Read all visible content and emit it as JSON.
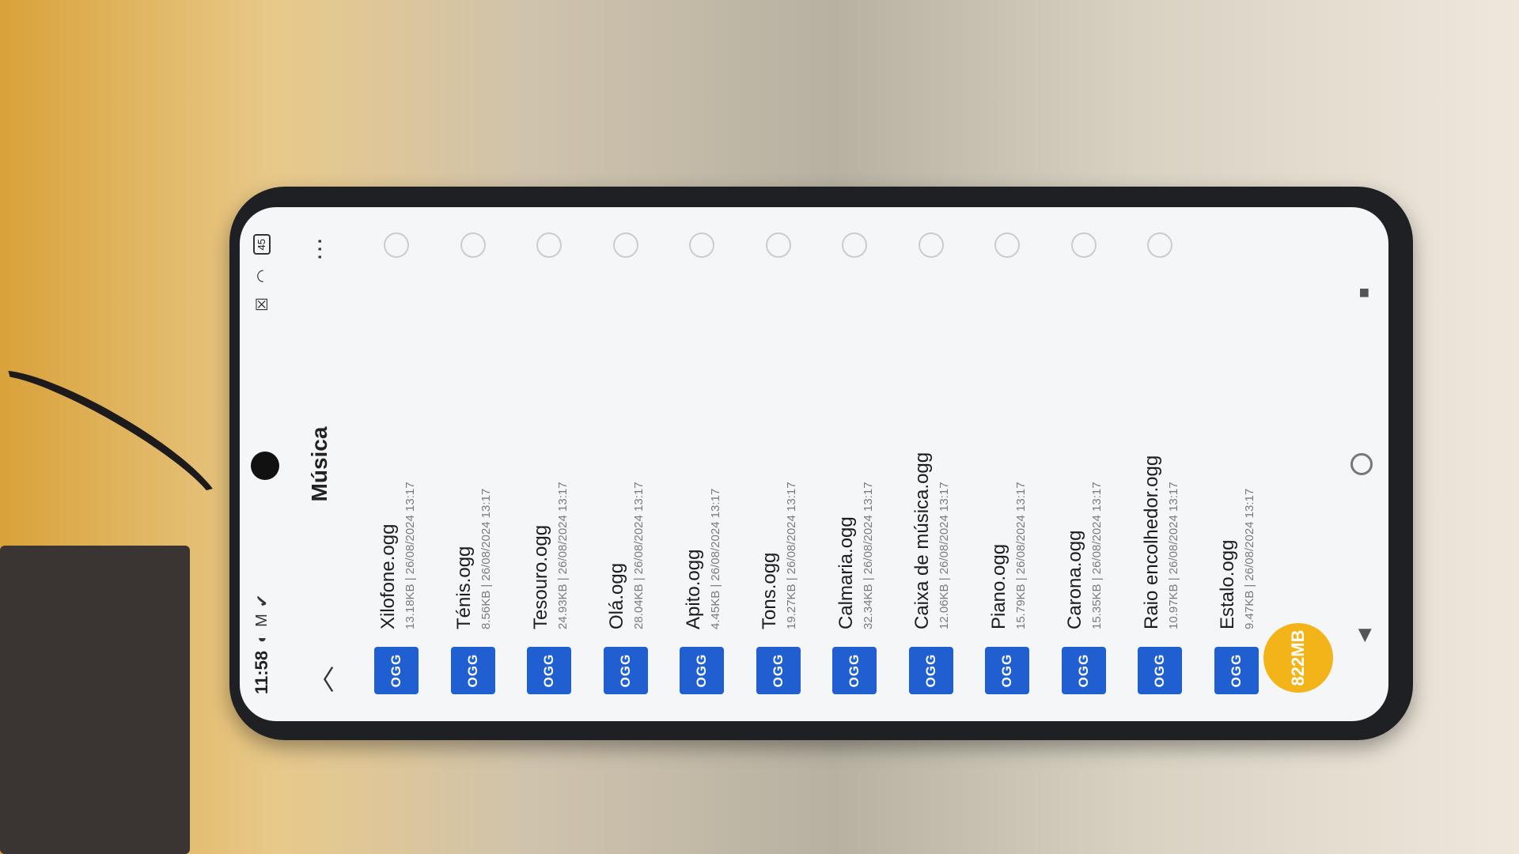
{
  "status_bar": {
    "time": "11:58",
    "battery": "45"
  },
  "app_bar": {
    "title": "Música"
  },
  "files": [
    {
      "icon": "OGG",
      "name": "Xilofone.ogg",
      "info": "13.18KB | 26/08/2024 13:17"
    },
    {
      "icon": "OGG",
      "name": "Ténis.ogg",
      "info": "8.56KB | 26/08/2024 13:17"
    },
    {
      "icon": "OGG",
      "name": "Tesouro.ogg",
      "info": "24.93KB | 26/08/2024 13:17"
    },
    {
      "icon": "OGG",
      "name": "Olá.ogg",
      "info": "28.04KB | 26/08/2024 13:17"
    },
    {
      "icon": "OGG",
      "name": "Apito.ogg",
      "info": "4.45KB | 26/08/2024 13:17"
    },
    {
      "icon": "OGG",
      "name": "Tons.ogg",
      "info": "19.27KB | 26/08/2024 13:17"
    },
    {
      "icon": "OGG",
      "name": "Calmaria.ogg",
      "info": "32.34KB | 26/08/2024 13:17"
    },
    {
      "icon": "OGG",
      "name": "Caixa de música.ogg",
      "info": "12.06KB | 26/08/2024 13:17"
    },
    {
      "icon": "OGG",
      "name": "Piano.ogg",
      "info": "15.79KB | 26/08/2024 13:17"
    },
    {
      "icon": "OGG",
      "name": "Carona.ogg",
      "info": "15.35KB | 26/08/2024 13:17"
    },
    {
      "icon": "OGG",
      "name": "Raio encolhedor.ogg",
      "info": "10.97KB | 26/08/2024 13:17"
    },
    {
      "icon": "OGG",
      "name": "Estalo.ogg",
      "info": "9.47KB | 26/08/2024 13:17"
    }
  ],
  "storage_badge": "822MB",
  "colors": {
    "file_icon": "#1f5fd1",
    "storage_badge": "#f2b418",
    "screen_bg": "#f5f6f8"
  },
  "icons": {
    "back": "chevron-up-icon",
    "more": "more-horizontal-icon",
    "nav_back": "back-triangle-icon",
    "nav_home": "home-circle-icon",
    "nav_recents": "recents-square-icon"
  }
}
